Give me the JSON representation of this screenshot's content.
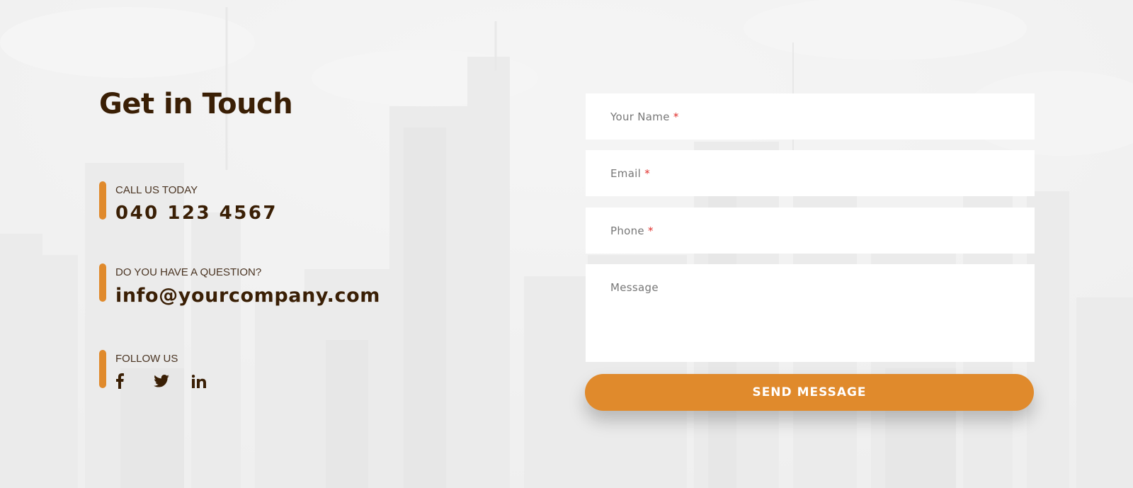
{
  "heading": "Get in Touch",
  "contact": {
    "phone": {
      "label": "CALL US TODAY",
      "value": "040 123 4567"
    },
    "email": {
      "label": "DO YOU HAVE A QUESTION?",
      "value": "info@yourcompany.com"
    },
    "follow": {
      "label": "FOLLOW US",
      "icons": [
        "facebook-icon",
        "twitter-icon",
        "linkedin-icon"
      ]
    }
  },
  "form": {
    "name_placeholder": "Your Name",
    "email_placeholder": "Email",
    "phone_placeholder": "Phone",
    "message_placeholder": "Message",
    "required_mark": "*",
    "submit_label": "SEND MESSAGE"
  },
  "colors": {
    "accent": "#e08a2c",
    "heading": "#3a1f05",
    "required": "#e0302c",
    "background": "#f0f0f0"
  }
}
